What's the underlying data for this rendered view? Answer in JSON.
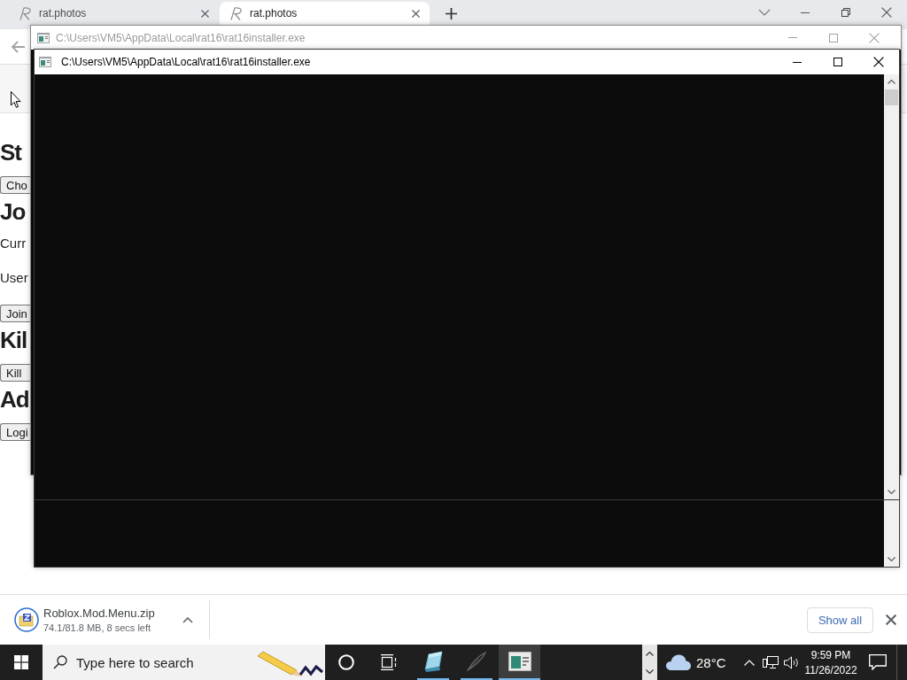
{
  "browser": {
    "tabs": [
      {
        "title": "rat.photos",
        "selected": false
      },
      {
        "title": "rat.photos",
        "selected": true
      }
    ]
  },
  "page": {
    "items": [
      {
        "kind": "heading",
        "text": "St"
      },
      {
        "kind": "button",
        "text": "Cho"
      },
      {
        "kind": "heading",
        "text": "Jo"
      },
      {
        "kind": "text",
        "text": "Curr"
      },
      {
        "kind": "text",
        "text": "User"
      },
      {
        "kind": "button",
        "text": "Join"
      },
      {
        "kind": "heading",
        "text": "Kil"
      },
      {
        "kind": "button",
        "text": "Kill"
      },
      {
        "kind": "heading",
        "text": "Ad"
      },
      {
        "kind": "button",
        "text": "Logi"
      }
    ]
  },
  "console_windows": [
    {
      "title": "C:\\Users\\VM5\\AppData\\Local\\rat16\\rat16installer.exe",
      "active": false
    },
    {
      "title": "C:\\Users\\VM5\\AppData\\Local\\rat16\\rat16installer.exe",
      "active": true
    }
  ],
  "download_bar": {
    "items": [
      {
        "name": "Roblox.Mod.Menu.zip",
        "status": "74.1/81.8 MB, 8 secs left"
      }
    ],
    "show_all": "Show all"
  },
  "taskbar": {
    "search": {
      "placeholder": "Type here to search"
    },
    "apps": [
      {
        "kind": "notes",
        "running": true,
        "selected": false
      },
      {
        "kind": "browser",
        "running": true,
        "selected": false
      },
      {
        "kind": "console",
        "running": true,
        "selected": true
      }
    ],
    "weather": "28°C",
    "time": "9:59 PM",
    "date": "11/26/2022"
  }
}
